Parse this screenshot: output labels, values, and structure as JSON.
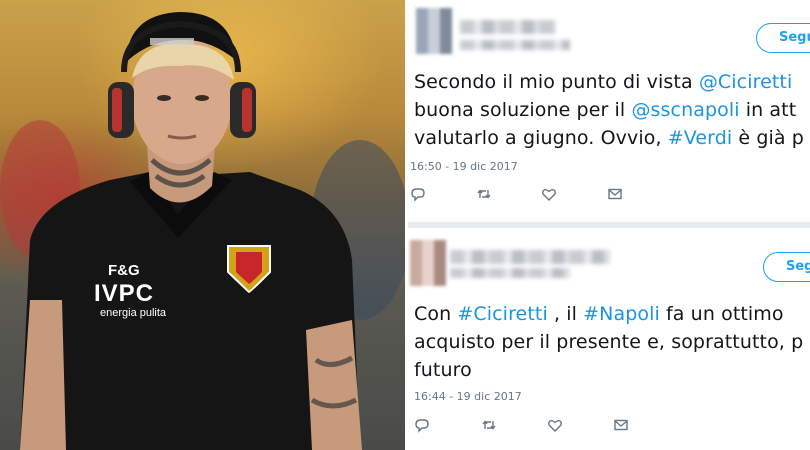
{
  "photo": {
    "jersey_sponsor_top": "F&G",
    "jersey_sponsor_main": "IVPC",
    "jersey_sponsor_sub": "energia pulita",
    "colors": {
      "jersey": "#151515",
      "hair": "#e8d6a8",
      "cap": "#111111"
    }
  },
  "tweets": [
    {
      "follow_label": "Segui",
      "line1_pre": "Secondo il mio punto di vista ",
      "line1_mention": "@Ciciretti",
      "line2_pre": "buona soluzione per il ",
      "line2_mention": "@sscnapoli",
      "line2_post": " in att",
      "line3_pre": "valutarlo a giugno. Ovvio, ",
      "line3_hashtag": "#Verdi",
      "line3_post": " è già p",
      "timestamp": "16:50 - 19 dic 2017"
    },
    {
      "follow_label": "Segu",
      "line1_pre": "Con ",
      "line1_hashtag1": "#Ciciretti",
      "line1_mid": " , il ",
      "line1_hashtag2": "#Napoli",
      "line1_post": " fa un ottimo",
      "line2": "acquisto per il presente e, soprattutto, p",
      "line3": "futuro",
      "timestamp": "16:44 - 19 dic 2017"
    }
  ],
  "icons": [
    "reply-icon",
    "retweet-icon",
    "like-icon",
    "direct-message-icon"
  ],
  "colors": {
    "link": "#1b95e0",
    "follow": "#1da1f2",
    "meta": "#657786"
  }
}
